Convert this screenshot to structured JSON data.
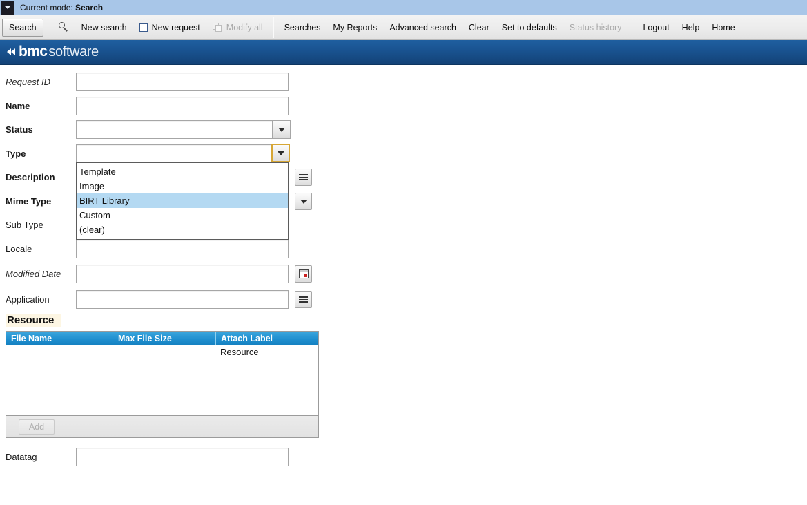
{
  "titlebar": {
    "prefix": "Current mode:",
    "mode": "Search",
    "menu_icon": "chevron-down-icon"
  },
  "toolbar": {
    "search_button": "Search",
    "items": [
      {
        "label": "New search",
        "icon": "none",
        "disabled": false
      },
      {
        "label": "New request",
        "icon": "new-request-icon",
        "disabled": false
      },
      {
        "label": "Modify all",
        "icon": "copy-icon",
        "disabled": true
      }
    ],
    "links": [
      {
        "label": "Searches",
        "disabled": false
      },
      {
        "label": "My Reports",
        "disabled": false
      },
      {
        "label": "Advanced search",
        "disabled": false
      },
      {
        "label": "Clear",
        "disabled": false
      },
      {
        "label": "Set to defaults",
        "disabled": false
      },
      {
        "label": "Status history",
        "disabled": true
      }
    ],
    "right_links": [
      {
        "label": "Logout"
      },
      {
        "label": "Help"
      },
      {
        "label": "Home"
      }
    ],
    "magnifier_icon": "search-icon"
  },
  "brand": {
    "bmc": "bmc",
    "software": "software",
    "bar_color": "#1a5492"
  },
  "form": {
    "fields": [
      {
        "label": "Request ID",
        "style": "italic",
        "value": "",
        "control": "text"
      },
      {
        "label": "Name",
        "style": "bold",
        "value": "",
        "control": "text"
      },
      {
        "label": "Status",
        "style": "bold",
        "value": "",
        "control": "select"
      },
      {
        "label": "Type",
        "style": "bold",
        "value": "",
        "control": "select-open"
      },
      {
        "label": "Description",
        "style": "bold",
        "value": "",
        "control": "text-menu"
      },
      {
        "label": "Mime Type",
        "style": "bold",
        "value": "",
        "control": "select"
      },
      {
        "label": "Sub Type",
        "style": "normal",
        "value": "",
        "control": "text"
      },
      {
        "label": "Locale",
        "style": "normal",
        "value": "",
        "control": "text"
      },
      {
        "label": "Modified Date",
        "style": "italic",
        "value": "",
        "control": "text-calendar"
      },
      {
        "label": "Application",
        "style": "normal",
        "value": "",
        "control": "text-menu"
      },
      {
        "label": "Datatag",
        "style": "normal",
        "value": "",
        "control": "text"
      }
    ],
    "type_dropdown": {
      "options": [
        "Template",
        "Image",
        "BIRT Library",
        "Custom",
        "(clear)"
      ],
      "selected_index": 2,
      "highlight_color": "#b4d9f2",
      "focus_border_color": "#d6a635"
    }
  },
  "resource": {
    "heading": "Resource",
    "columns": [
      "File Name",
      "Max File Size",
      "Attach Label"
    ],
    "rows": [
      {
        "file_name": "",
        "max_file_size": "",
        "attach_label": "Resource"
      }
    ],
    "add_button": "Add",
    "add_button_disabled": true,
    "header_color": "#1f8fcf"
  }
}
